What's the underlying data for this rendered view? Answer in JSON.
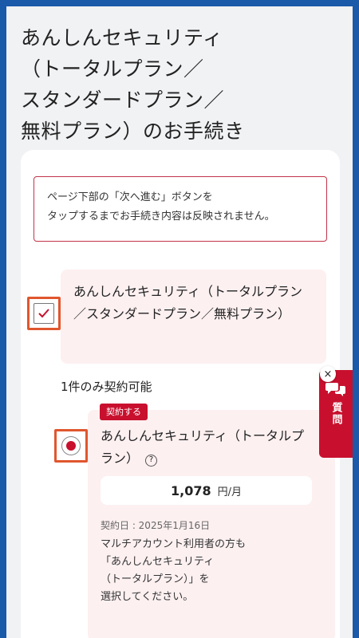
{
  "header": {
    "title_lines": [
      "あんしんセキュリティ",
      "（トータルプラン／",
      "スタンダードプラン／",
      "無料プラン）のお手続き"
    ]
  },
  "notice": {
    "lines": [
      "ページ下部の「次へ進む」ボタンを",
      "タップするまでお手続き内容は反映されません。"
    ]
  },
  "product": {
    "label": "あんしんセキュリティ（トータルプラン／スタンダードプラン／無料プラン）",
    "checked": true
  },
  "plans": {
    "limit_text": "1件のみ契約可能",
    "selected": {
      "badge": "契約する",
      "name": "あんしんセキュリティ（トータルプラン）",
      "help_icon": "question-icon",
      "price": "1,078",
      "price_unit": "円/月",
      "contract_date": "契約日 : 2025年1月16日",
      "note_lines": [
        "マルチアカウント利用者の方も",
        "「あんしんセキュリティ",
        "（トータルプラン）」を",
        "選択してください。"
      ]
    }
  },
  "question_tab": {
    "label": "質問",
    "icon": "chat-bubbles-icon",
    "close_icon": "close-icon",
    "close_glyph": "×"
  },
  "colors": {
    "accent": "#c8102e",
    "highlight_border": "#e0562e",
    "frame": "#1a5aa8",
    "pink_bg": "#fdf0f1"
  }
}
